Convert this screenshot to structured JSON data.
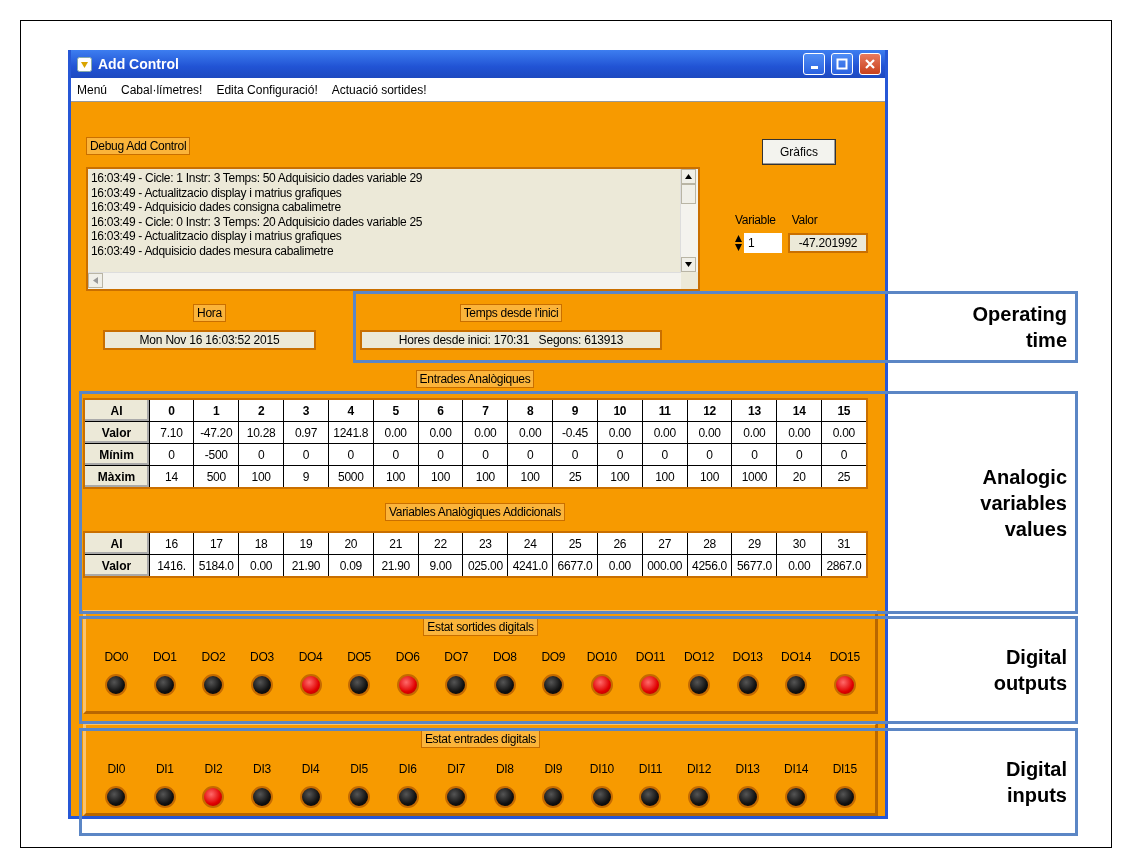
{
  "window": {
    "title": "Add Control"
  },
  "menu": [
    "Menú",
    "Cabal·límetres!",
    "Edita Configuració!",
    "Actuació sortides!"
  ],
  "debug": {
    "title": "Debug Add Control",
    "lines": [
      "16:03:49 - Cicle: 1 Instr: 3 Temps: 50 Adquisicio dades variable 29",
      "16:03:49 - Actualitzacio display i matrius grafiques",
      "16:03:49 - Adquisicio dades consigna cabalimetre",
      "16:03:49 - Cicle: 0 Instr: 3 Temps: 20 Adquisicio dades variable 25",
      "16:03:49 - Actualitzacio display i matrius grafiques",
      "16:03:49 - Adquisicio dades mesura cabalimetre"
    ]
  },
  "graphics_button": "Gràfics",
  "variable": {
    "label": "Variable",
    "value": "1"
  },
  "valor": {
    "label": "Valor",
    "value": "-47.201992"
  },
  "hora": {
    "label": "Hora",
    "value": "Mon Nov 16 16:03:52 2015"
  },
  "temps": {
    "label": "Temps desde l'inici",
    "value": "Hores desde inici: 170:31   Segons: 613913"
  },
  "analog_inputs": {
    "title": "Entrades Analògiques",
    "header": [
      "AI",
      "0",
      "1",
      "2",
      "3",
      "4",
      "5",
      "6",
      "7",
      "8",
      "9",
      "10",
      "11",
      "12",
      "13",
      "14",
      "15"
    ],
    "rows": [
      {
        "label": "Valor",
        "cells": [
          "7.10",
          "-47.20",
          "10.28",
          "0.97",
          "1241.8",
          "0.00",
          "0.00",
          "0.00",
          "0.00",
          "-0.45",
          "0.00",
          "0.00",
          "0.00",
          "0.00",
          "0.00",
          "0.00"
        ]
      },
      {
        "label": "Mínim",
        "cells": [
          "0",
          "-500",
          "0",
          "0",
          "0",
          "0",
          "0",
          "0",
          "0",
          "0",
          "0",
          "0",
          "0",
          "0",
          "0",
          "0"
        ]
      },
      {
        "label": "Màxim",
        "cells": [
          "14",
          "500",
          "100",
          "9",
          "5000",
          "100",
          "100",
          "100",
          "100",
          "25",
          "100",
          "100",
          "100",
          "1000",
          "20",
          "25"
        ]
      }
    ]
  },
  "additional_variables": {
    "title": "Variables Analògiques Addicionals",
    "header": [
      "AI",
      "16",
      "17",
      "18",
      "19",
      "20",
      "21",
      "22",
      "23",
      "24",
      "25",
      "26",
      "27",
      "28",
      "29",
      "30",
      "31"
    ],
    "rows": [
      {
        "label": "Valor",
        "cells": [
          "1416.",
          "5184.0",
          "0.00",
          "21.90",
          "0.09",
          "21.90",
          "9.00",
          "025.00",
          "4241.0",
          "6677.0",
          "0.00",
          "000.00",
          "4256.0",
          "5677.0",
          "0.00",
          "2867.0"
        ]
      }
    ]
  },
  "digital_outputs": {
    "title": "Estat sortides digitals",
    "items": [
      {
        "label": "DO0",
        "on": false
      },
      {
        "label": "DO1",
        "on": false
      },
      {
        "label": "DO2",
        "on": false
      },
      {
        "label": "DO3",
        "on": false
      },
      {
        "label": "DO4",
        "on": true
      },
      {
        "label": "DO5",
        "on": false
      },
      {
        "label": "DO6",
        "on": true
      },
      {
        "label": "DO7",
        "on": false
      },
      {
        "label": "DO8",
        "on": false
      },
      {
        "label": "DO9",
        "on": false
      },
      {
        "label": "DO10",
        "on": true
      },
      {
        "label": "DO11",
        "on": true
      },
      {
        "label": "DO12",
        "on": false
      },
      {
        "label": "DO13",
        "on": false
      },
      {
        "label": "DO14",
        "on": false
      },
      {
        "label": "DO15",
        "on": true
      }
    ]
  },
  "digital_inputs": {
    "title": "Estat entrades digitals",
    "items": [
      {
        "label": "DI0",
        "on": false
      },
      {
        "label": "DI1",
        "on": false
      },
      {
        "label": "DI2",
        "on": true
      },
      {
        "label": "DI3",
        "on": false
      },
      {
        "label": "DI4",
        "on": false
      },
      {
        "label": "DI5",
        "on": false
      },
      {
        "label": "DI6",
        "on": false
      },
      {
        "label": "DI7",
        "on": false
      },
      {
        "label": "DI8",
        "on": false
      },
      {
        "label": "DI9",
        "on": false
      },
      {
        "label": "DI10",
        "on": false
      },
      {
        "label": "DI11",
        "on": false
      },
      {
        "label": "DI12",
        "on": false
      },
      {
        "label": "DI13",
        "on": false
      },
      {
        "label": "DI14",
        "on": false
      },
      {
        "label": "DI15",
        "on": false
      }
    ]
  },
  "annotations": [
    {
      "label": "Operating time"
    },
    {
      "label": "Analogic variables values"
    },
    {
      "label": "Digital outputs"
    },
    {
      "label": "Digital inputs"
    }
  ]
}
